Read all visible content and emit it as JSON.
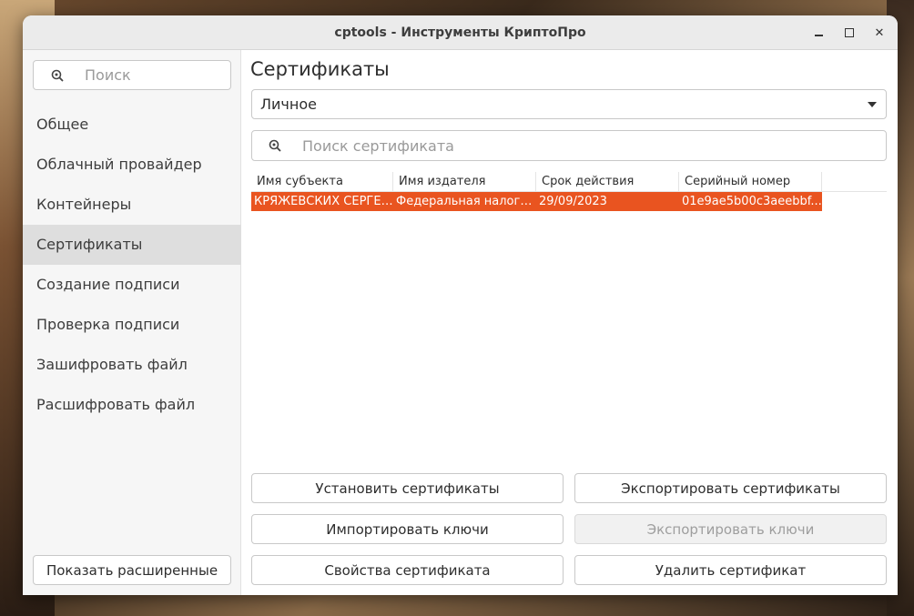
{
  "window": {
    "title": "cptools - Инструменты КриптоПро"
  },
  "sidebar": {
    "search_placeholder": "Поиск",
    "items": [
      {
        "label": "Общее",
        "active": false
      },
      {
        "label": "Облачный провайдер",
        "active": false
      },
      {
        "label": "Контейнеры",
        "active": false
      },
      {
        "label": "Сертификаты",
        "active": true
      },
      {
        "label": "Создание подписи",
        "active": false
      },
      {
        "label": "Проверка подписи",
        "active": false
      },
      {
        "label": "Зашифровать файл",
        "active": false
      },
      {
        "label": "Расшифровать файл",
        "active": false
      }
    ],
    "show_advanced_label": "Показать расширенные"
  },
  "main": {
    "title": "Сертификаты",
    "store_selected": "Личное",
    "cert_search_placeholder": "Поиск сертификата",
    "table": {
      "columns": [
        "Имя субъекта",
        "Имя издателя",
        "Срок действия",
        "Серийный номер"
      ],
      "rows": [
        [
          "КРЯЖЕВСКИХ СЕРГЕЙ...",
          "Федеральная налого...",
          "29/09/2023",
          "01e9ae5b00c3aeebbf..."
        ]
      ]
    },
    "buttons": {
      "install": "Установить сертификаты",
      "export_certs": "Экспортировать сертификаты",
      "import_keys": "Импортировать ключи",
      "export_keys": "Экспортировать ключи",
      "properties": "Свойства сертификата",
      "delete": "Удалить сертификат"
    }
  },
  "colors": {
    "selection": "#e95420",
    "sidebar_bg": "#f6f6f6",
    "sidebar_active": "#dedede"
  }
}
